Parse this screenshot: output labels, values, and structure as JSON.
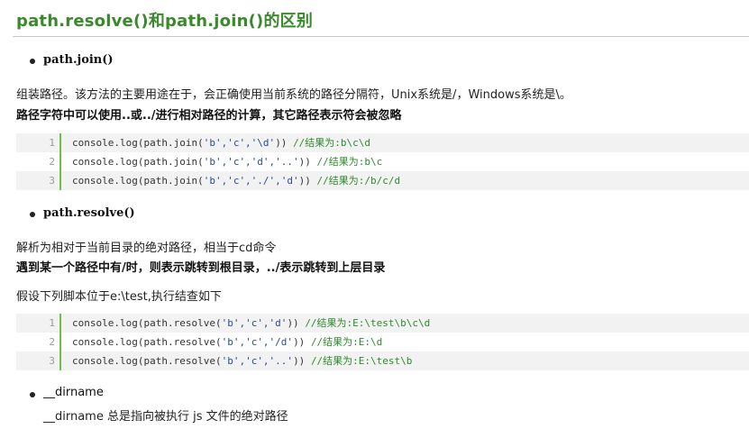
{
  "title": "path.resolve()和path.join()的区别",
  "sections": {
    "join": {
      "label": "path.join()",
      "desc1": "组装路径。该方法的主要用途在于，会正确使用当前系统的路径分隔符，Unix系统是/，Windows系统是\\。",
      "desc2": "路径字符中可以使用..或../进行相对路径的计算，其它路径表示符会被忽略",
      "code": [
        {
          "num": "1",
          "pre": "console.log(path.join(",
          "str": "'b','c','\\d'",
          "post": ")) ",
          "comment": "//结果为:b\\c\\d"
        },
        {
          "num": "2",
          "pre": "console.log(path.join(",
          "str": "'b','c','d','..'",
          "post": ")) ",
          "comment": "//结果为:b\\c"
        },
        {
          "num": "3",
          "pre": "console.log(path.join(",
          "str": "'b','c','./','d'",
          "post": ")) ",
          "comment": "//结果为:/b/c/d"
        }
      ]
    },
    "resolve": {
      "label": "path.resolve()",
      "desc1": "解析为相对于当前目录的绝对路径，相当于cd命令",
      "desc2": "遇到某一个路径中有/时，则表示跳转到根目录，../表示跳转到上层目录",
      "desc3": "假设下列脚本位于e:\\test,执行结查如下",
      "code": [
        {
          "num": "1",
          "pre": "console.log(path.resolve(",
          "str": "'b','c','d'",
          "post": ")) ",
          "comment": "//结果为:E:\\test\\b\\c\\d"
        },
        {
          "num": "2",
          "pre": "console.log(path.resolve(",
          "str": "'b','c','/d'",
          "post": ")) ",
          "comment": "//结果为:E:\\d"
        },
        {
          "num": "3",
          "pre": "console.log(path.resolve(",
          "str": "'b','c','..'",
          "post": ")) ",
          "comment": "//结果为:E:\\test\\b"
        }
      ]
    },
    "dirname": {
      "label": "__dirname",
      "desc": "__dirname 总是指向被执行 js 文件的绝对路径"
    }
  },
  "colors": {
    "title": "#3a8a2c",
    "gutter": "#6cc04a",
    "comment": "#2e8b2e",
    "string": "#2a4aa0"
  }
}
